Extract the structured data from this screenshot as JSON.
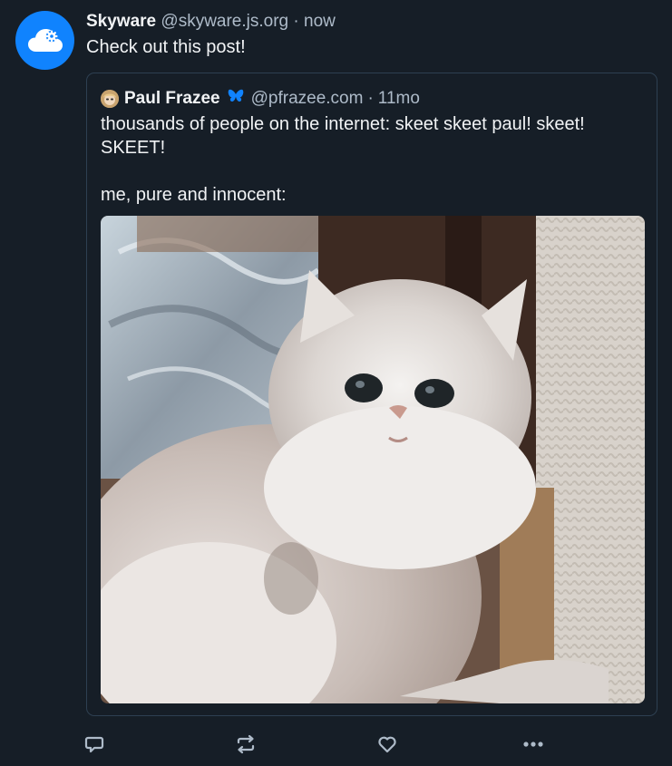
{
  "post": {
    "author": {
      "display_name": "Skyware",
      "handle": "@skyware.js.org",
      "avatar_icon": "cloud-gear-icon",
      "avatar_color": "#1083fe"
    },
    "separator": "·",
    "timestamp": "now",
    "text": "Check out this post!"
  },
  "quote": {
    "author": {
      "display_name": "Paul Frazee",
      "handle": "@pfrazee.com",
      "badge_icon": "butterfly-icon",
      "badge_color": "#1083fe"
    },
    "separator": "·",
    "timestamp": "11mo",
    "text_line1": "thousands of people on the internet: skeet skeet paul! skeet! SKEET!",
    "text_line2": "me, pure and innocent:",
    "image_subject": "fluffy white persian kitten"
  },
  "actions": {
    "reply_icon": "reply-icon",
    "repost_icon": "repost-icon",
    "like_icon": "heart-icon",
    "more_icon": "more-icon",
    "icon_color": "#aebbc9"
  },
  "colors": {
    "background": "#161e27",
    "text_primary": "#f1f3f5",
    "text_secondary": "#aebbc9",
    "border": "#2e4052"
  }
}
